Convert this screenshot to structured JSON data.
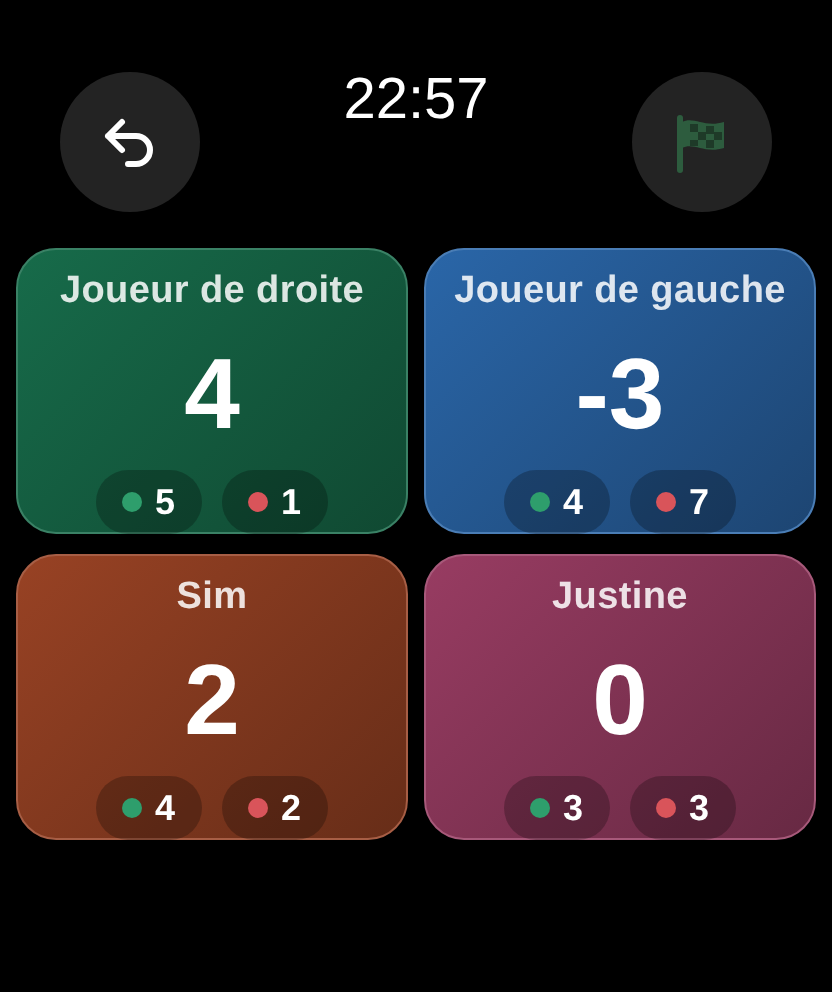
{
  "header": {
    "time": "22:57"
  },
  "players": [
    {
      "name": "Joueur de droite",
      "score": "4",
      "color": "#176b4a",
      "stats": [
        {
          "color": "#2e9e6c",
          "value": "5"
        },
        {
          "color": "#d9545a",
          "value": "1"
        }
      ]
    },
    {
      "name": "Joueur de gauche",
      "score": "-3",
      "color": "#2a66a8",
      "stats": [
        {
          "color": "#2e9e6c",
          "value": "4"
        },
        {
          "color": "#d9545a",
          "value": "7"
        }
      ]
    },
    {
      "name": "Sim",
      "score": "2",
      "color": "#984224",
      "stats": [
        {
          "color": "#2e9e6c",
          "value": "4"
        },
        {
          "color": "#d9545a",
          "value": "2"
        }
      ]
    },
    {
      "name": "Justine",
      "score": "0",
      "color": "#983c62",
      "stats": [
        {
          "color": "#2e9e6c",
          "value": "3"
        },
        {
          "color": "#d9545a",
          "value": "3"
        }
      ]
    }
  ]
}
